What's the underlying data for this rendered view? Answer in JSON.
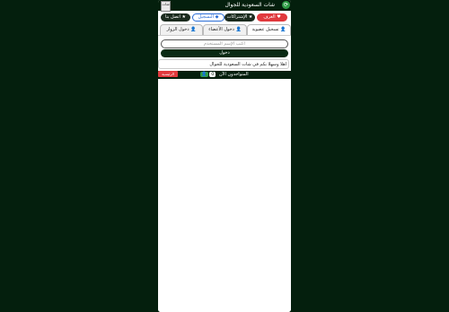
{
  "header": {
    "title": "شات السعودية للجوال",
    "refresh_icon": "refresh-icon",
    "logo_text": "شات"
  },
  "toolbar": {
    "rooms_label": "الغرف",
    "subscriptions_label": "الإشتراكات",
    "register_label": "التسجيل",
    "contact_label": "اتصل بنا"
  },
  "tabs": {
    "register_member": "تسجيل عضوية",
    "member_login": "دخول الأعضاء",
    "guest_login": "دخول الزوار"
  },
  "login": {
    "username_placeholder": "اكتب الإسم المستخدم",
    "submit_label": "دخول"
  },
  "welcome_text": "اهلا وسهلا بكم في شات السعودية للجوال",
  "online": {
    "label": "المتواجدون الآن",
    "count": "0",
    "home_label": "الرئيسية"
  },
  "colors": {
    "background": "#041f0d",
    "accent_red": "#e0393d",
    "accent_green": "#2e9b45",
    "accent_blue": "#2a6dd6"
  }
}
